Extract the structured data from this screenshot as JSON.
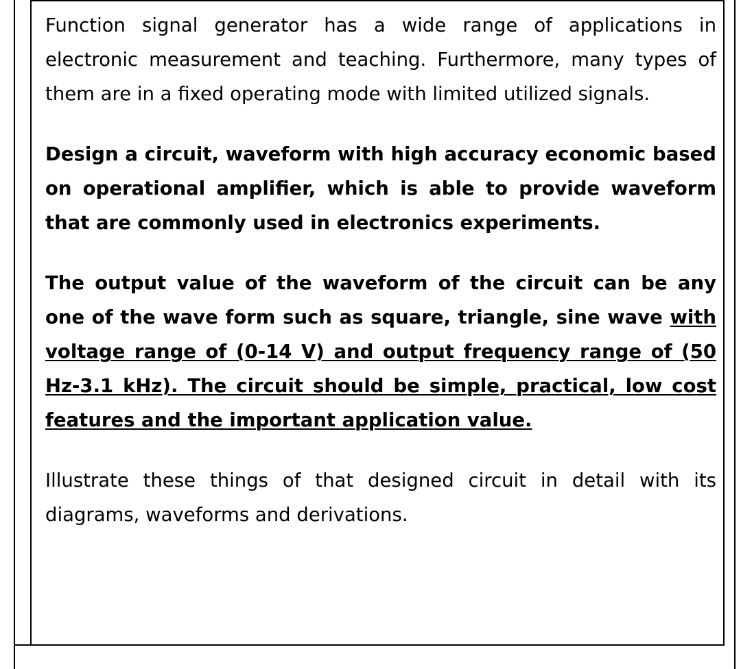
{
  "document": {
    "paragraphs": [
      {
        "id": "intro",
        "style": "regular",
        "text": "Function signal generator has a wide range of applications in electronic measurement and teaching. Furthermore, many types of them are in a fixed operating mode with limited utilized signals."
      },
      {
        "id": "design-task",
        "style": "bold",
        "text": "Design a circuit, waveform with high accuracy economic based on operational amplifier, which is able to provide waveform that are commonly used in electronics experiments."
      },
      {
        "id": "output-spec-plain",
        "style": "bold",
        "text": "The output value of the waveform of the circuit can be any one of the wave form such as square, triangle, sine wave "
      },
      {
        "id": "output-spec-underlined",
        "style": "bold-underline",
        "text": "with voltage range of (0-14 V) and output frequency range of (50 Hz-3.1 kHz). The circuit should be simple, practical, low cost features and the important application value."
      },
      {
        "id": "illustrate",
        "style": "regular",
        "text": "Illustrate these things of that designed circuit in detail with its diagrams, waveforms and derivations."
      }
    ]
  }
}
